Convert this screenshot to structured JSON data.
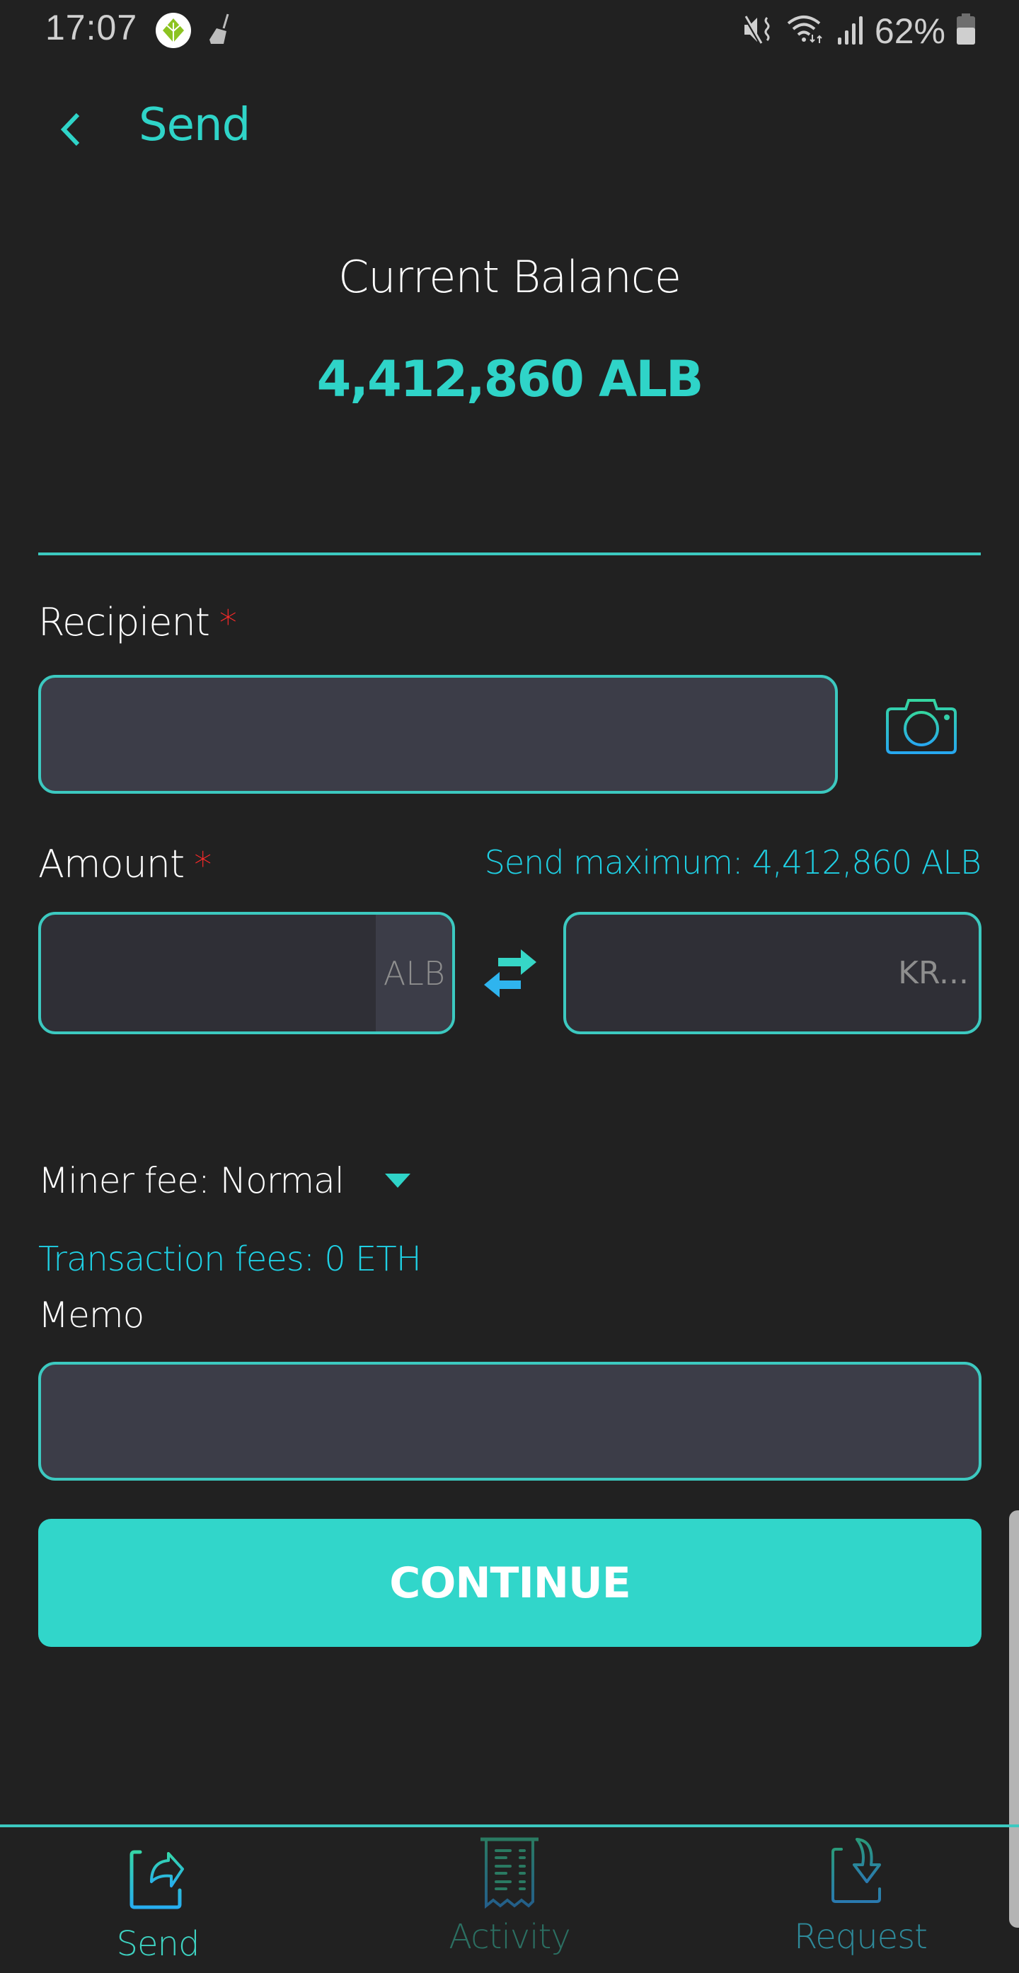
{
  "status_bar": {
    "time": "17:07",
    "battery_percent": "62%",
    "icons": [
      "app-leaf-icon",
      "broom-clean-icon",
      "mute-vibrate-icon",
      "wifi-icon",
      "signal-icon",
      "battery-icon"
    ]
  },
  "header": {
    "back_icon": "chevron-left-icon",
    "title": "Send"
  },
  "balance": {
    "label": "Current Balance",
    "value": "4,412,860 ALB"
  },
  "form": {
    "recipient": {
      "label": "Recipient",
      "required_mark": "*",
      "value": "",
      "placeholder": "",
      "scan_icon": "camera-icon"
    },
    "amount": {
      "label": "Amount",
      "required_mark": "*",
      "send_max": "Send maximum: 4,412,860 ALB",
      "crypto_value": "",
      "crypto_suffix": "ALB",
      "swap_icon": "swap-arrows-icon",
      "fiat_value": "",
      "fiat_placeholder": "KR..."
    },
    "miner_fee": {
      "label": "Miner fee: Normal",
      "selected": "Normal"
    },
    "transaction_fees": "Transaction fees: 0 ETH",
    "memo": {
      "label": "Memo",
      "value": "",
      "placeholder": ""
    },
    "continue_label": "CONTINUE"
  },
  "bottom_nav": {
    "items": [
      {
        "label": "Send",
        "icon": "send-share-icon",
        "active": true
      },
      {
        "label": "Activity",
        "icon": "receipt-icon",
        "active": false
      },
      {
        "label": "Request",
        "icon": "request-download-icon",
        "active": false
      }
    ]
  },
  "colors": {
    "background": "#212121",
    "accent": "#2fd4c8",
    "link": "#1fd0e4",
    "required": "#ff2a2a",
    "input_bg": "#3c3d48"
  }
}
